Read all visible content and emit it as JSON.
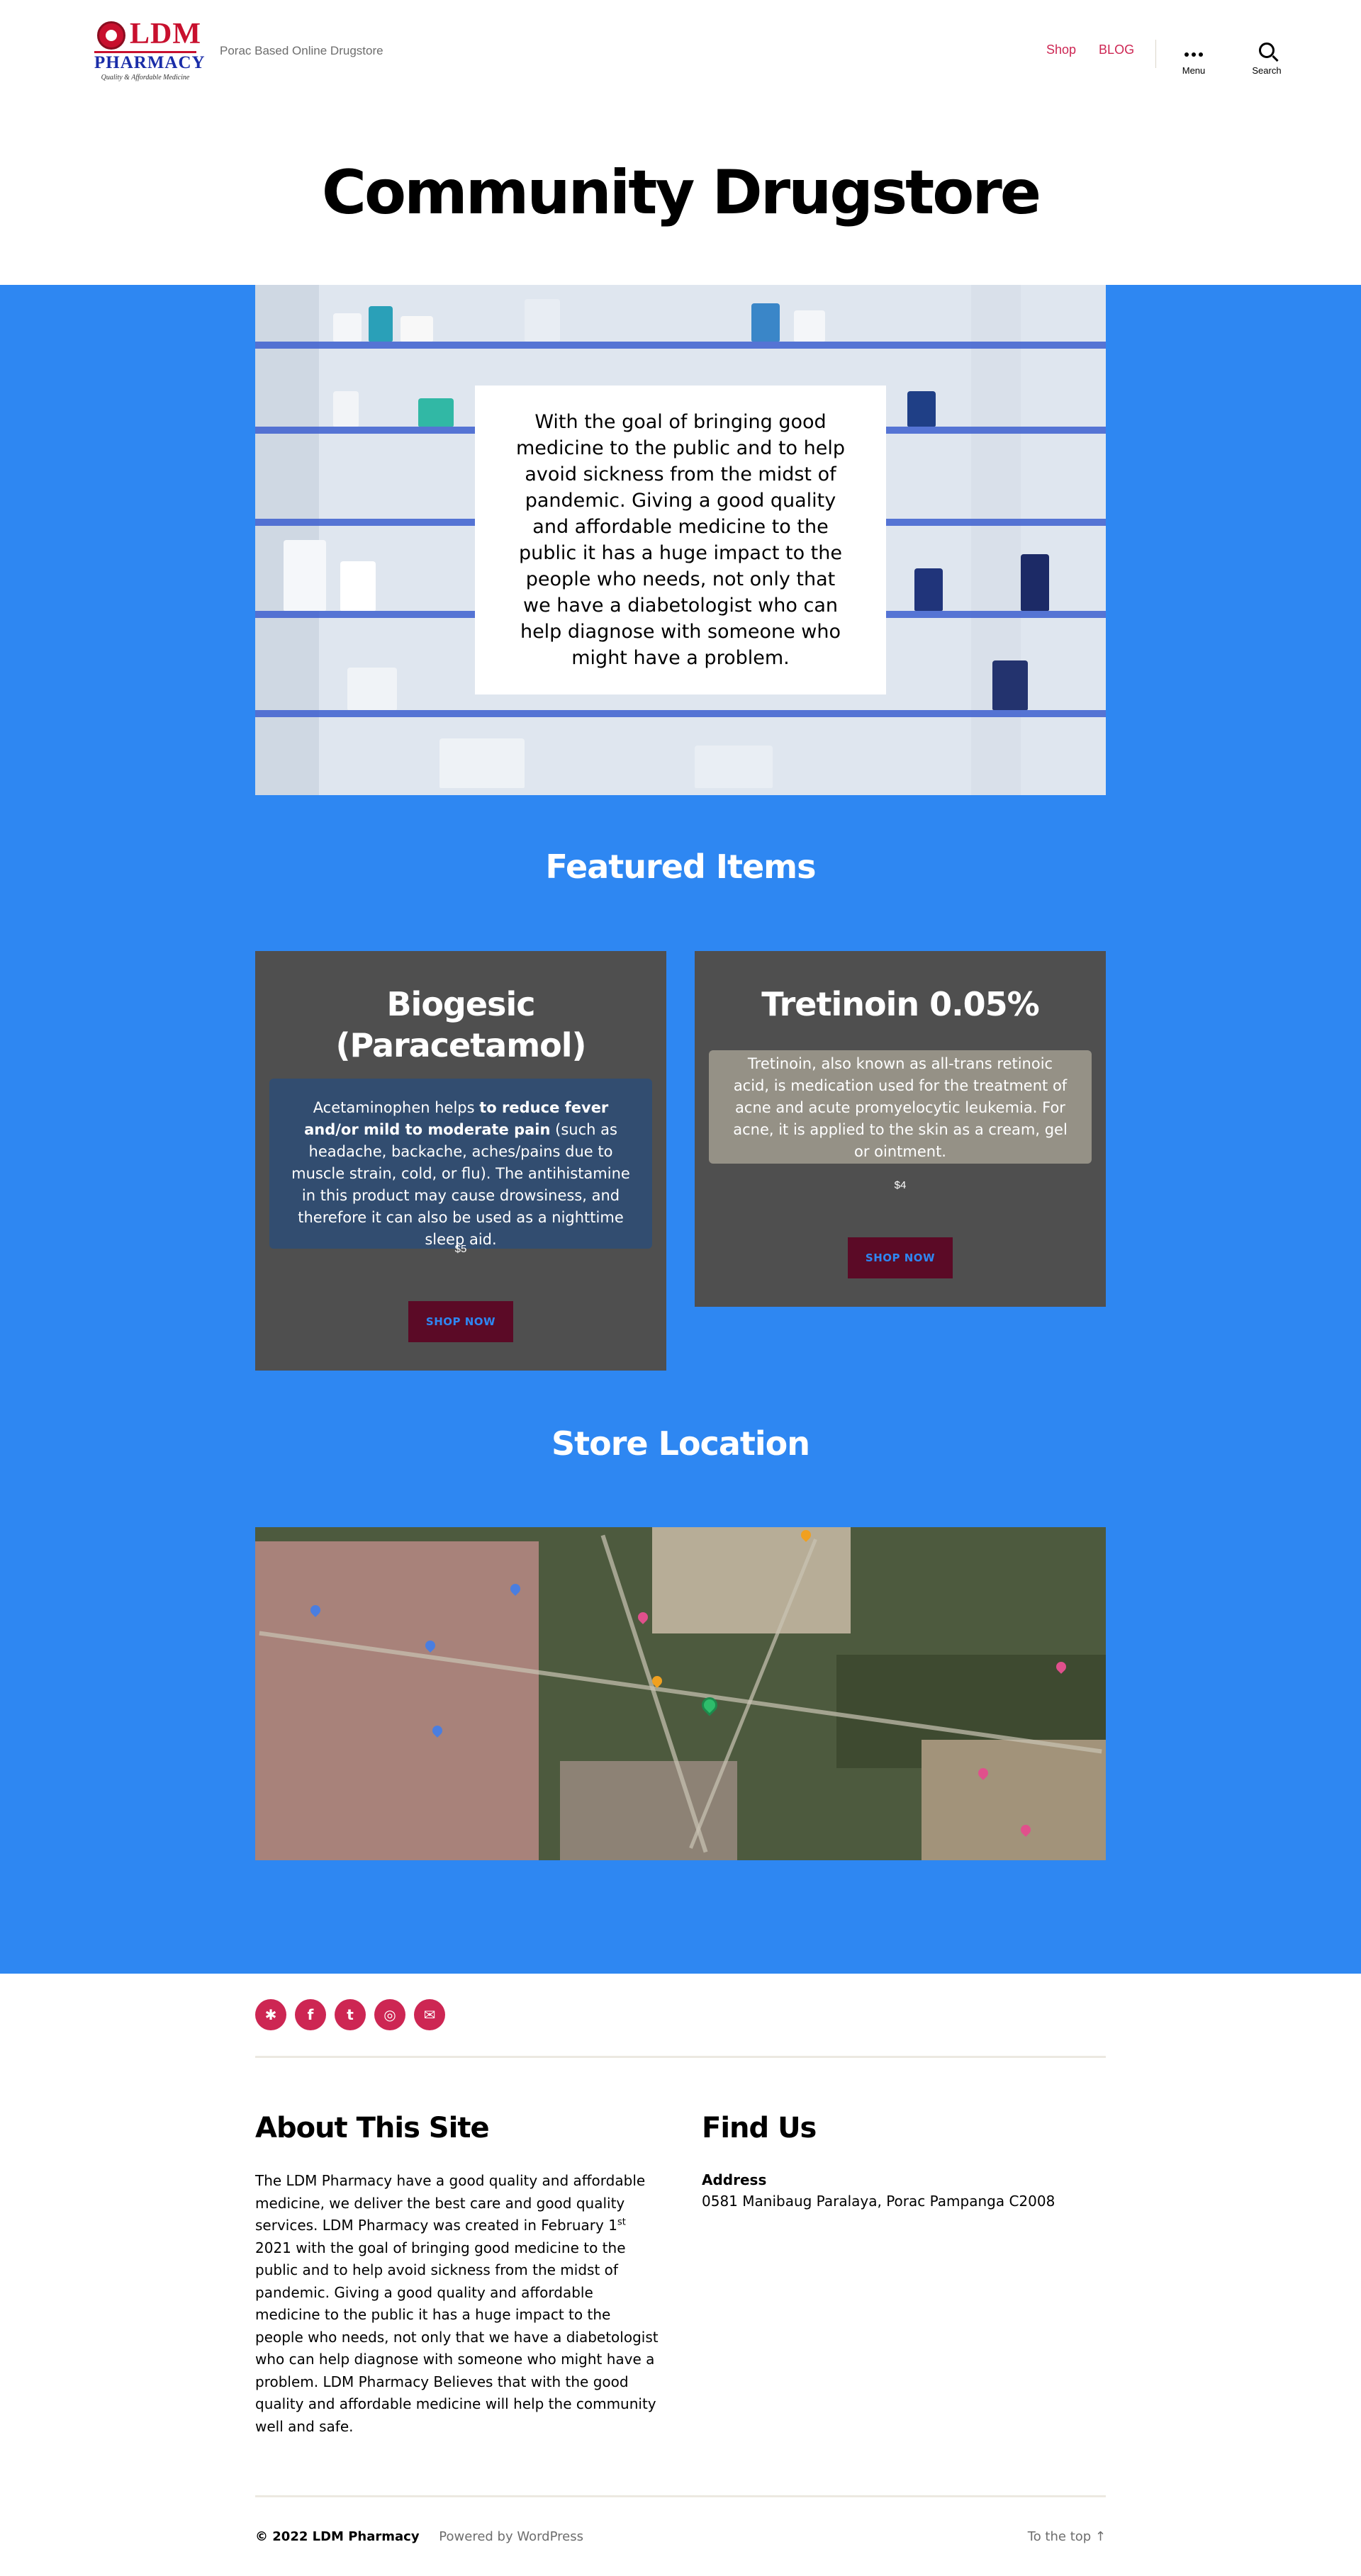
{
  "header": {
    "logo": {
      "name": "LDM",
      "sub": "PHARMACY",
      "tagline": "Quality & Affordable Medicine"
    },
    "description": "Porac Based Online Drugstore",
    "nav": [
      "Shop",
      "BLOG"
    ],
    "menu_label": "Menu",
    "search_label": "Search"
  },
  "page": {
    "title": "Community Drugstore",
    "hero_text": "With the goal of bringing good medicine to the public and to help avoid sickness from the midst of pandemic. Giving a good quality and affordable medicine to the public it has a huge impact to the people who needs, not only that we have a diabetologist who can help diagnose with someone who might have a problem."
  },
  "featured": {
    "heading": "Featured Items",
    "products": [
      {
        "title_line1": "Biogesic",
        "title_line2": "(Paracetamol)",
        "desc_plain_1": "Acetaminophen helps ",
        "desc_bold": "to reduce fever and/or mild to moderate pain",
        "desc_plain_2": " (such as headache, backache, aches/pains due to muscle strain, cold, or flu). The antihistamine in this product may cause drowsiness, and therefore it can also be used as a nighttime sleep aid.",
        "price": "$5",
        "button": "SHOP NOW"
      },
      {
        "title": "Tretinoin 0.05%",
        "desc": "Tretinoin, also known as all-trans retinoic acid, is medication used for the treatment of acne and acute promyelocytic leukemia. For acne, it is applied to the skin as a cream, gel or ointment.",
        "price": "$4",
        "button": "SHOP NOW"
      }
    ]
  },
  "location": {
    "heading": "Store Location"
  },
  "footer": {
    "social": [
      "yelp-icon",
      "facebook-icon",
      "twitter-icon",
      "instagram-icon",
      "mail-icon"
    ],
    "about_title": "About This Site",
    "about_text_1": "The LDM Pharmacy have a good quality and affordable medicine, we deliver the best care and good quality services. LDM Pharmacy was created in February 1",
    "about_sup": "st",
    "about_text_2": " 2021 with the goal of bringing good medicine to the public and to help avoid sickness from the midst of pandemic. Giving a good quality and affordable medicine to the public it has a huge impact to the people who needs, not only that we have a diabetologist who can help diagnose with someone who might have a problem. LDM Pharmacy Believes that with the good quality and affordable medicine will help the community well and safe.",
    "find_title": "Find Us",
    "address_label": "Address",
    "address": "0581 Manibaug Paralaya, Porac Pampanga C2008",
    "copyright": "© 2022 LDM Pharmacy",
    "powered": "Powered by WordPress",
    "to_top": "To the top ↑"
  },
  "colors": {
    "accent": "#cd2653",
    "band_blue": "#2e87f2",
    "card_gray": "#4f4f4f",
    "button_maroon": "#5b0a26"
  }
}
